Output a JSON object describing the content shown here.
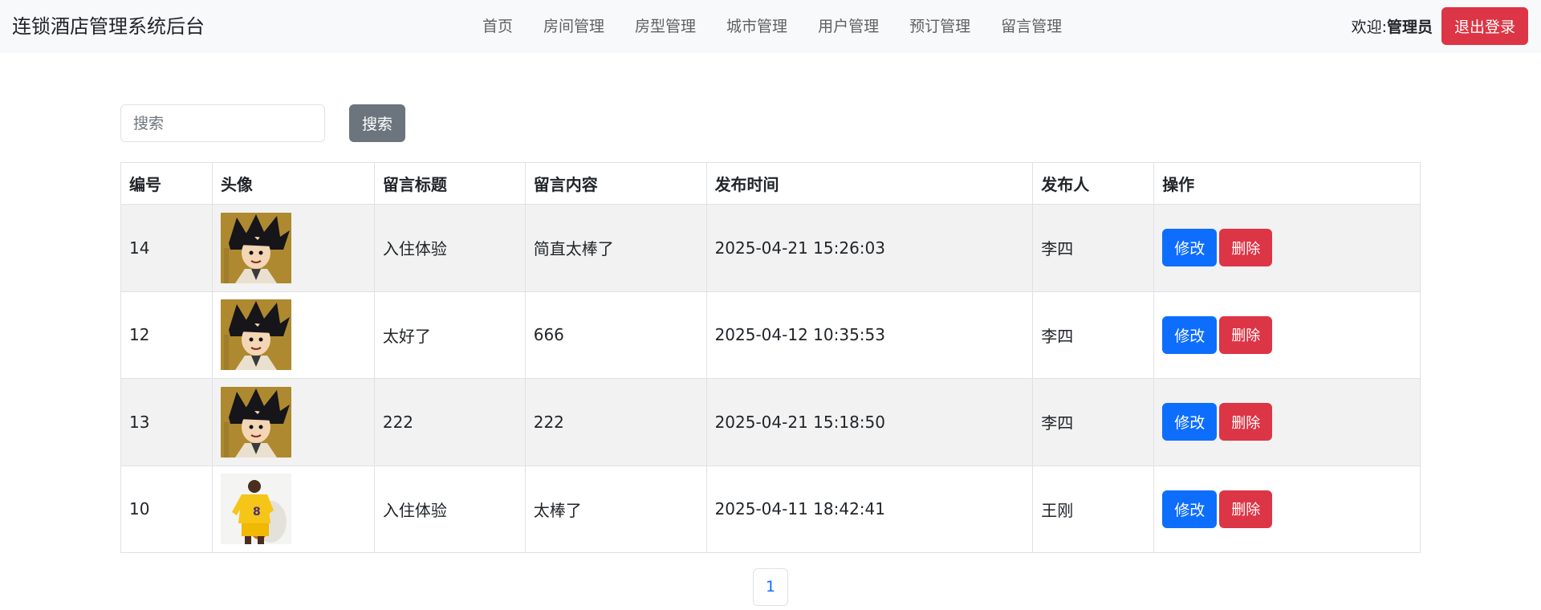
{
  "header": {
    "brand": "连锁酒店管理系统后台",
    "nav": [
      {
        "label": "首页"
      },
      {
        "label": "房间管理"
      },
      {
        "label": "房型管理"
      },
      {
        "label": "城市管理"
      },
      {
        "label": "用户管理"
      },
      {
        "label": "预订管理"
      },
      {
        "label": "留言管理"
      }
    ],
    "welcome_prefix": "欢迎:",
    "user_name": "管理员",
    "logout_label": "退出登录"
  },
  "search": {
    "placeholder": "搜索",
    "value": "",
    "button_label": "搜索"
  },
  "table": {
    "columns": [
      "编号",
      "头像",
      "留言标题",
      "留言内容",
      "发布时间",
      "发布人",
      "操作"
    ],
    "rows": [
      {
        "id": "14",
        "avatar": "goku-avatar",
        "title": "入住体验",
        "content": "简直太棒了",
        "time": "2025-04-21 15:26:03",
        "author": "李四",
        "edit_label": "修改",
        "delete_label": "删除"
      },
      {
        "id": "12",
        "avatar": "goku-avatar",
        "title": "太好了",
        "content": "666",
        "time": "2025-04-12 10:35:53",
        "author": "李四",
        "edit_label": "修改",
        "delete_label": "删除"
      },
      {
        "id": "13",
        "avatar": "goku-avatar",
        "title": "222",
        "content": "222",
        "time": "2025-04-21 15:18:50",
        "author": "李四",
        "edit_label": "修改",
        "delete_label": "删除"
      },
      {
        "id": "10",
        "avatar": "basketball-player-avatar",
        "title": "入住体验",
        "content": "太棒了",
        "time": "2025-04-11 18:42:41",
        "author": "王刚",
        "edit_label": "修改",
        "delete_label": "删除"
      }
    ]
  },
  "pagination": {
    "pages": [
      "1"
    ],
    "current": "1"
  },
  "colors": {
    "primary": "#0d6efd",
    "danger": "#dc3545",
    "secondary": "#6c757d",
    "navbar_bg": "#f8f9fa",
    "stripe": "#f2f2f2"
  }
}
